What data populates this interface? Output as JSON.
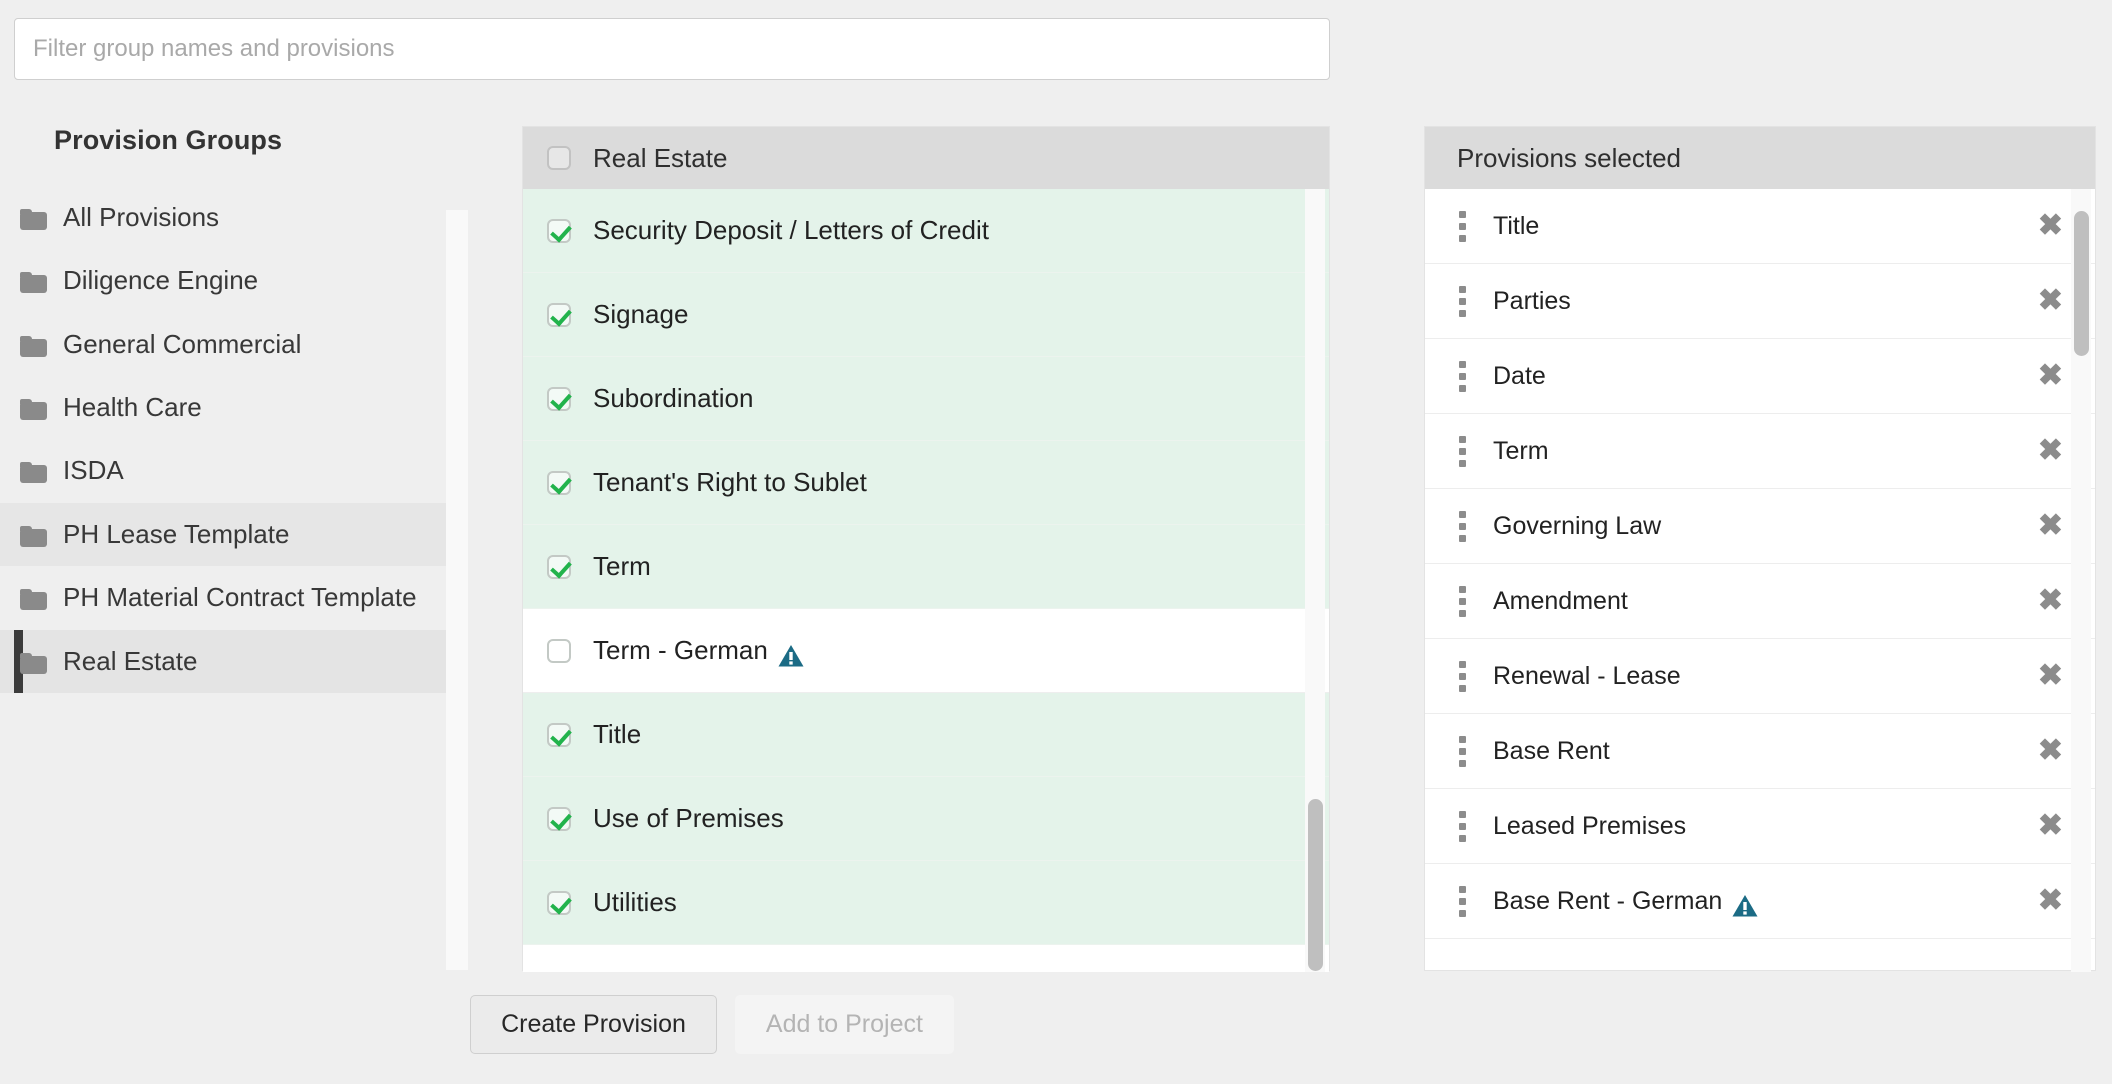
{
  "search": {
    "placeholder": "Filter group names and provisions",
    "value": ""
  },
  "sidebar": {
    "title": "Provision Groups",
    "items": [
      {
        "label": "All Provisions",
        "state": "normal"
      },
      {
        "label": "Diligence Engine",
        "state": "normal"
      },
      {
        "label": "General Commercial",
        "state": "normal"
      },
      {
        "label": "Health Care",
        "state": "normal"
      },
      {
        "label": "ISDA",
        "state": "normal"
      },
      {
        "label": "PH Lease Template",
        "state": "hovered"
      },
      {
        "label": "PH Material Contract Template",
        "state": "normal"
      },
      {
        "label": "Real Estate",
        "state": "active"
      }
    ]
  },
  "provisions_panel": {
    "header": "Real Estate",
    "header_checked": false,
    "rows": [
      {
        "label": "Security Deposit / Letters of Credit",
        "checked": true,
        "warning": false
      },
      {
        "label": "Signage",
        "checked": true,
        "warning": false
      },
      {
        "label": "Subordination",
        "checked": true,
        "warning": false
      },
      {
        "label": "Tenant's Right to Sublet",
        "checked": true,
        "warning": false
      },
      {
        "label": "Term",
        "checked": true,
        "warning": false
      },
      {
        "label": "Term - German",
        "checked": false,
        "warning": true
      },
      {
        "label": "Title",
        "checked": true,
        "warning": false
      },
      {
        "label": "Use of Premises",
        "checked": true,
        "warning": false
      },
      {
        "label": "Utilities",
        "checked": true,
        "warning": false
      }
    ]
  },
  "selected_panel": {
    "header": "Provisions selected",
    "remove_glyph": "✖",
    "rows": [
      {
        "label": "Title",
        "warning": false
      },
      {
        "label": "Parties",
        "warning": false
      },
      {
        "label": "Date",
        "warning": false
      },
      {
        "label": "Term",
        "warning": false
      },
      {
        "label": "Governing Law",
        "warning": false
      },
      {
        "label": "Amendment",
        "warning": false
      },
      {
        "label": "Renewal - Lease",
        "warning": false
      },
      {
        "label": "Base Rent",
        "warning": false
      },
      {
        "label": "Leased Premises",
        "warning": false
      },
      {
        "label": "Base Rent - German",
        "warning": true
      }
    ]
  },
  "footer": {
    "create_label": "Create Provision",
    "add_label": "Add to Project",
    "add_enabled": false
  },
  "colors": {
    "checked_row_bg": "#e4f3ea",
    "check_green": "#22b34c",
    "warning_teal": "#1b6b85",
    "panel_header_bg": "#dbdbdb",
    "active_marker": "#3b3b3b"
  }
}
